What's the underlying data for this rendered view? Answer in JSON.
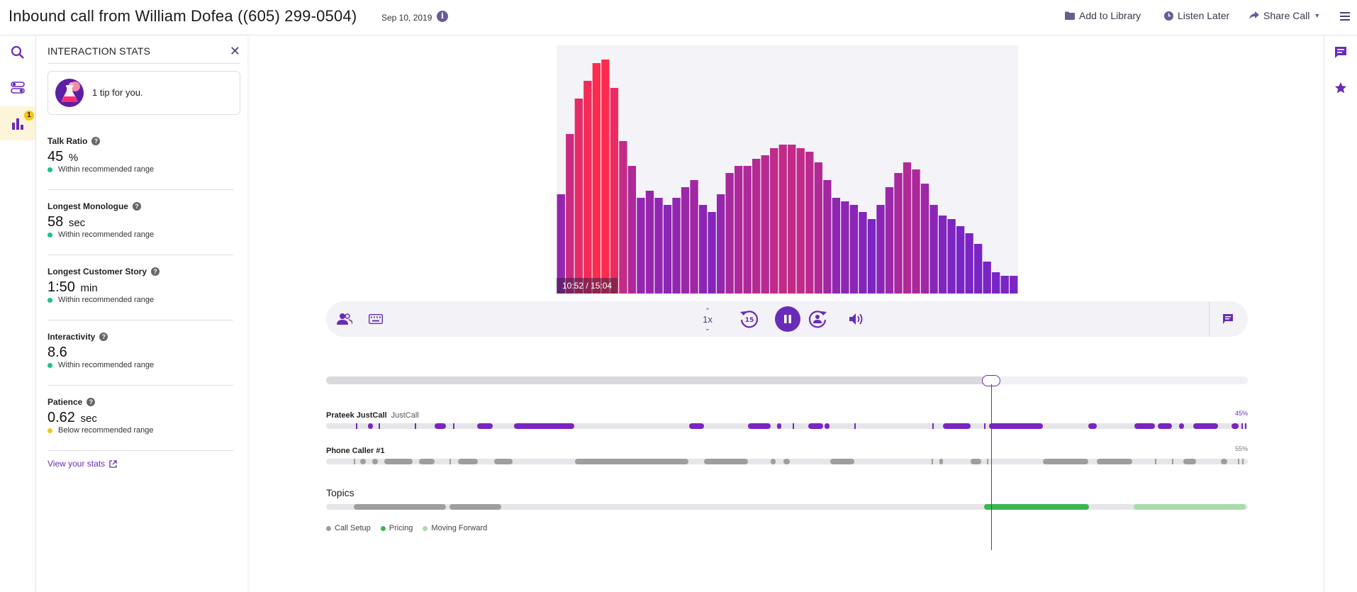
{
  "header": {
    "title": "Inbound call from William Dofea ((605) 299-0504)",
    "date": "Sep 10, 2019",
    "info_icon": "info-icon",
    "actions": [
      {
        "label": "Add to Library",
        "icon": "folder-icon"
      },
      {
        "label": "Listen Later",
        "icon": "clock-icon"
      },
      {
        "label": "Share Call",
        "icon": "share-icon"
      }
    ],
    "menu_icon": "hamburger-menu-icon"
  },
  "left_rail": {
    "items": [
      {
        "icon": "search-icon"
      },
      {
        "icon": "toggles-icon"
      },
      {
        "icon": "bar-chart-icon",
        "badge": "1",
        "active": true
      }
    ]
  },
  "stats_panel": {
    "title": "INTERACTION STATS",
    "tip_text": "1 tip for you.",
    "stats": [
      {
        "label": "Talk Ratio",
        "value": "45",
        "unit": "%",
        "range": "Within recommended range",
        "status_color": "#1fbf8f"
      },
      {
        "label": "Longest Monologue",
        "value": "58",
        "unit": "sec",
        "range": "Within recommended range",
        "status_color": "#1fbf8f"
      },
      {
        "label": "Longest Customer Story",
        "value": "1:50",
        "unit": "min",
        "range": "Within recommended range",
        "status_color": "#1fbf8f"
      },
      {
        "label": "Interactivity",
        "value": "8.6",
        "unit": "",
        "range": "Within recommended range",
        "status_color": "#1fbf8f"
      },
      {
        "label": "Patience",
        "value": "0.62",
        "unit": "sec",
        "range": "Below recommended range",
        "status_color": "#f5c518"
      }
    ],
    "view_stats_label": "View your stats"
  },
  "right_rail": {
    "items": [
      {
        "icon": "comment-icon"
      },
      {
        "icon": "star-icon"
      }
    ]
  },
  "player": {
    "timecode": "10:52 / 15:04",
    "speed": "1x",
    "progress_fraction": 0.721,
    "skip_back_seconds": "15"
  },
  "chart_data": {
    "type": "bar",
    "values": [
      28,
      45,
      55,
      60,
      65,
      66,
      58,
      43,
      36,
      27,
      29,
      27,
      25,
      27,
      30,
      32,
      25,
      23,
      28,
      34,
      36,
      36,
      38,
      39,
      41,
      42,
      42,
      41,
      40,
      37,
      32,
      27,
      26,
      25,
      23,
      21,
      25,
      30,
      34,
      37,
      35,
      31,
      25,
      22,
      21,
      19,
      17,
      14,
      9,
      6,
      5,
      5
    ],
    "colors": {
      "low": "#7a24c4",
      "mid": "#c42a87",
      "high": "#ff2b4e"
    }
  },
  "tracks": [
    {
      "speaker": "Prateek JustCall",
      "sub": "JustCall",
      "percent": "45%",
      "color": "#7a24c4",
      "segments": [
        [
          0.032,
          0.035
        ],
        [
          0.045,
          0.051
        ],
        [
          0.057,
          0.06
        ],
        [
          0.096,
          0.099
        ],
        [
          0.118,
          0.13
        ],
        [
          0.138,
          0.142
        ],
        [
          0.164,
          0.181
        ],
        [
          0.204,
          0.269
        ],
        [
          0.394,
          0.41
        ],
        [
          0.458,
          0.482
        ],
        [
          0.489,
          0.494
        ],
        [
          0.506,
          0.509
        ],
        [
          0.523,
          0.539
        ],
        [
          0.541,
          0.546
        ],
        [
          0.573,
          0.575
        ],
        [
          0.658,
          0.66
        ],
        [
          0.669,
          0.699
        ],
        [
          0.714,
          0.716
        ],
        [
          0.719,
          0.778
        ],
        [
          0.827,
          0.836
        ],
        [
          0.877,
          0.899
        ],
        [
          0.902,
          0.918
        ],
        [
          0.925,
          0.931
        ],
        [
          0.941,
          0.968
        ],
        [
          0.982,
          0.99
        ],
        [
          0.993,
          0.995
        ],
        [
          0.997,
          0.999
        ]
      ]
    },
    {
      "speaker": "Phone Caller #1",
      "sub": "",
      "percent": "55%",
      "color": "#9e9e9e",
      "segments": [
        [
          0.03,
          0.031
        ],
        [
          0.037,
          0.043
        ],
        [
          0.05,
          0.056
        ],
        [
          0.063,
          0.094
        ],
        [
          0.101,
          0.118
        ],
        [
          0.134,
          0.135
        ],
        [
          0.143,
          0.165
        ],
        [
          0.182,
          0.202
        ],
        [
          0.27,
          0.393
        ],
        [
          0.41,
          0.458
        ],
        [
          0.482,
          0.488
        ],
        [
          0.496,
          0.503
        ],
        [
          0.547,
          0.573
        ],
        [
          0.657,
          0.658
        ],
        [
          0.665,
          0.669
        ],
        [
          0.699,
          0.711
        ],
        [
          0.717,
          0.718
        ],
        [
          0.778,
          0.827
        ],
        [
          0.836,
          0.875
        ],
        [
          0.899,
          0.901
        ],
        [
          0.918,
          0.919
        ],
        [
          0.93,
          0.944
        ],
        [
          0.971,
          0.978
        ],
        [
          0.989,
          0.99
        ],
        [
          0.994,
          0.996
        ]
      ]
    }
  ],
  "topics": {
    "label": "Topics",
    "segments": [
      {
        "name": "Call Setup",
        "from": 0.03,
        "to": 0.13,
        "color": "#9e9e9e"
      },
      {
        "name": "Call Setup",
        "from": 0.134,
        "to": 0.19,
        "color": "#9e9e9e"
      },
      {
        "name": "Pricing",
        "from": 0.714,
        "to": 0.828,
        "color": "#3cb553"
      },
      {
        "name": "Moving Forward",
        "from": 0.876,
        "to": 0.998,
        "color": "#a8dcaa"
      }
    ],
    "legend": [
      {
        "name": "Call Setup",
        "color": "#9e9e9e"
      },
      {
        "name": "Pricing",
        "color": "#3cb553"
      },
      {
        "name": "Moving Forward",
        "color": "#a8dcaa"
      }
    ]
  }
}
